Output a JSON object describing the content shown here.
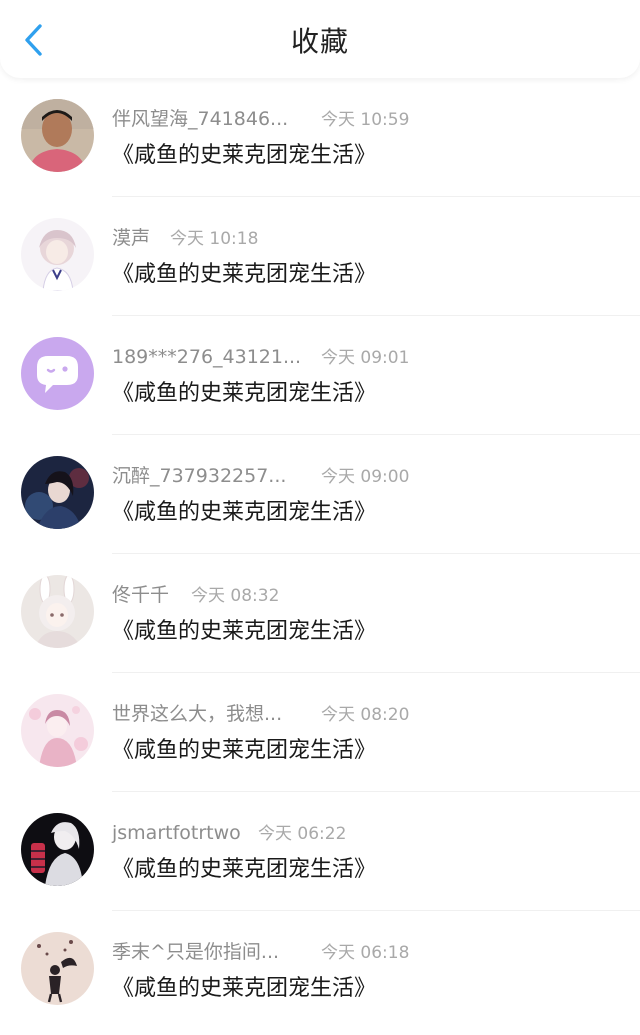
{
  "header": {
    "title": "收藏"
  },
  "items": [
    {
      "user": "伴风望海_741846...",
      "time": "今天 10:59",
      "book": "《咸鱼的史莱克团宠生活》"
    },
    {
      "user": "漠声",
      "time": "今天 10:18",
      "book": "《咸鱼的史莱克团宠生活》"
    },
    {
      "user": "189***276_43121...",
      "time": "今天 09:01",
      "book": "《咸鱼的史莱克团宠生活》"
    },
    {
      "user": "沉醉_737932257...",
      "time": "今天 09:00",
      "book": "《咸鱼的史莱克团宠生活》"
    },
    {
      "user": "佟千千",
      "time": "今天 08:32",
      "book": "《咸鱼的史莱克团宠生活》"
    },
    {
      "user": "世界这么大，我想...",
      "time": "今天 08:20",
      "book": "《咸鱼的史莱克团宠生活》"
    },
    {
      "user": "jsmartfotrtwo",
      "time": "今天 06:22",
      "book": "《咸鱼的史莱克团宠生活》"
    },
    {
      "user": "季末^只是你指间...",
      "time": "今天 06:18",
      "book": "《咸鱼的史莱克团宠生活》"
    }
  ],
  "colors": {
    "accent": "#2fa0ee",
    "default_avatar": "#c9a8ee"
  }
}
